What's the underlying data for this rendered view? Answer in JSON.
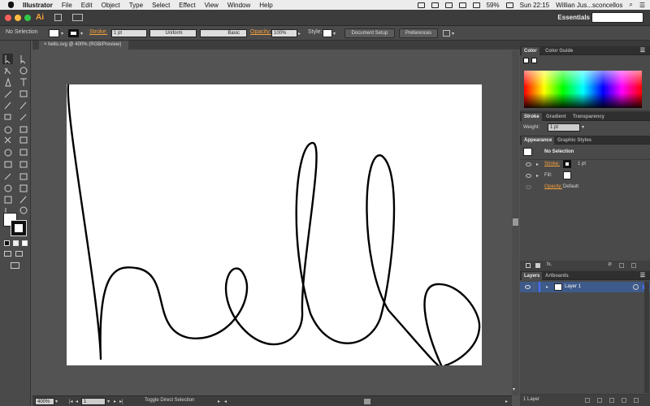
{
  "menubar": {
    "app_name": "Illustrator",
    "items": [
      "File",
      "Edit",
      "Object",
      "Type",
      "Select",
      "Effect",
      "View",
      "Window",
      "Help"
    ],
    "battery": "59%",
    "clock": "Sun 22:15",
    "user": "Willian Jus...sconcellos"
  },
  "appbar": {
    "logo": "Ai",
    "workspace": "Essentials",
    "workspace_caret": "▾"
  },
  "controlbar": {
    "selection": "No Selection",
    "stroke_label": "Stroke:",
    "stroke_value": "1 pt",
    "profile_uniform": "Uniform",
    "brush_basic": "Basic",
    "opacity_label": "Opacity:",
    "opacity_value": "100%",
    "style_label": "Style:",
    "document_setup": "Document Setup",
    "preferences": "Preferences"
  },
  "document": {
    "tab_title": "hello.svg @ 400% (RGB/Preview)",
    "close": "×"
  },
  "status": {
    "zoom": "400%",
    "page": "1",
    "tool_hint": "Toggle Direct Selection"
  },
  "panels": {
    "color_tabs": [
      "Color",
      "Color Guide"
    ],
    "stroke_tabs": [
      "Stroke",
      "Gradient",
      "Transparency"
    ],
    "weight_label": "Weight:",
    "weight_value": "1 pt",
    "appearance_tabs": [
      "Appearance",
      "Graphic Styles"
    ],
    "appearance_title": "No Selection",
    "stroke_label": "Stroke:",
    "stroke_value": "1 pt",
    "fill_label": "Fill:",
    "opacity_label": "Opacity:",
    "opacity_value": "Default",
    "fx_label": "fx.",
    "layers_tabs": [
      "Layers",
      "Artboards"
    ],
    "layer_name": "Layer 1",
    "layers_count": "1 Layer"
  },
  "colors": {
    "accent": "#f7a23b",
    "traffic_red": "#fc605c",
    "traffic_yellow": "#fdbc40",
    "traffic_green": "#34c84a",
    "layer_color": "#4f6ef7"
  }
}
